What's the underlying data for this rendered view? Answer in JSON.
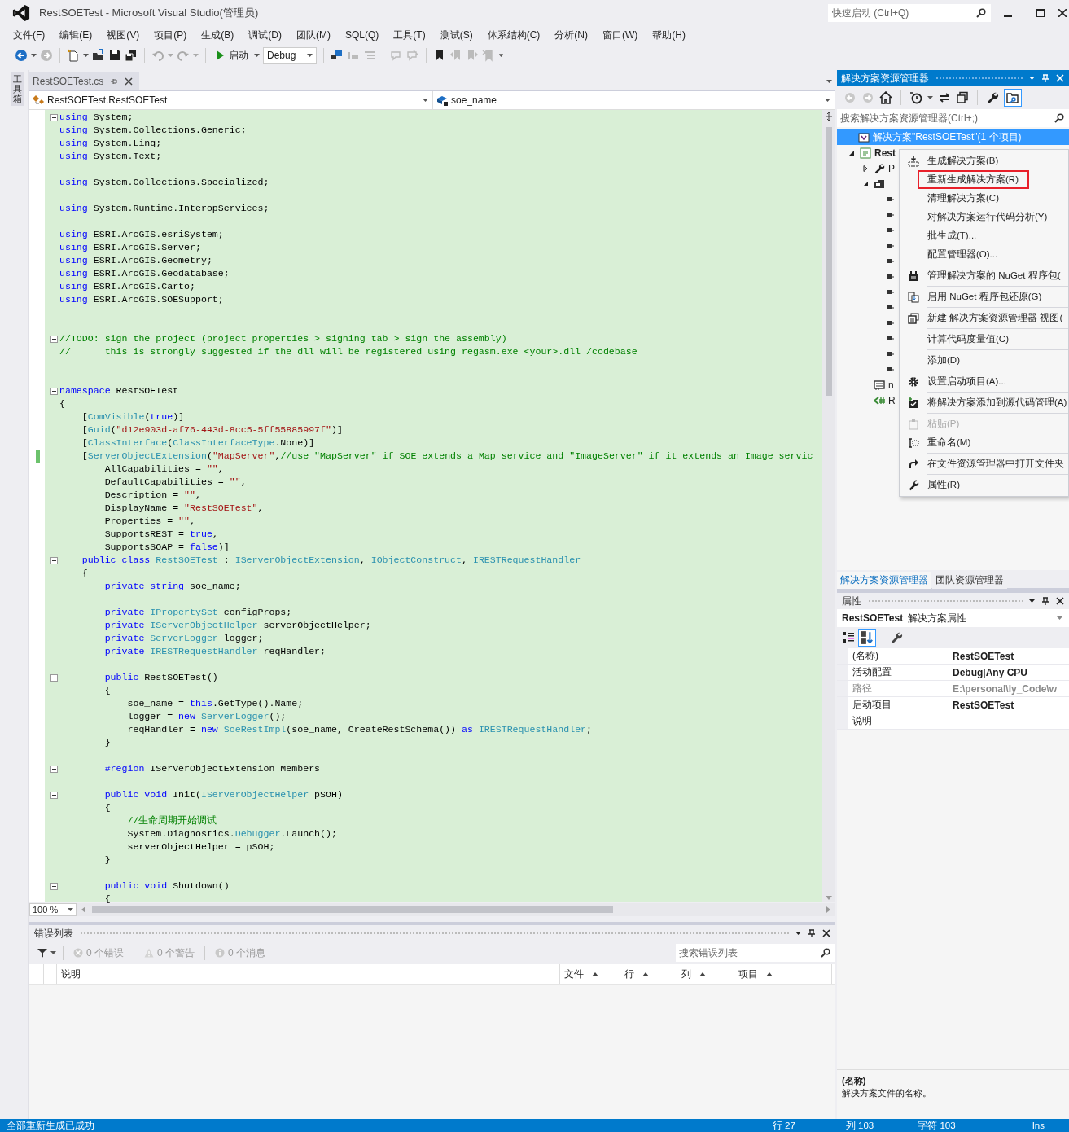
{
  "window": {
    "title": "RestSOETest - Microsoft Visual Studio(管理员)",
    "quick_launch": {
      "placeholder": "快速启动 (Ctrl+Q)"
    }
  },
  "menu": [
    "文件(F)",
    "编辑(E)",
    "视图(V)",
    "项目(P)",
    "生成(B)",
    "调试(D)",
    "团队(M)",
    "SQL(Q)",
    "工具(T)",
    "测试(S)",
    "体系结构(C)",
    "分析(N)",
    "窗口(W)",
    "帮助(H)"
  ],
  "toolbar": {
    "start_label": "启动",
    "configuration": "Debug"
  },
  "toolbox_tab": "工具箱",
  "document_tabs": [
    {
      "label": "RestSOETest.cs",
      "selected": true
    }
  ],
  "navigation": {
    "type_dropdown": "RestSOETest.RestSOETest",
    "member_dropdown": "soe_name"
  },
  "editor": {
    "zoom": "100 %",
    "lines": [
      {
        "fold": true,
        "modified": false,
        "tokens": [
          {
            "kind": "keyword",
            "text": "using"
          },
          {
            "kind": "plain",
            "text": " System;"
          }
        ]
      },
      {
        "fold": false,
        "modified": false,
        "tokens": [
          {
            "kind": "keyword",
            "text": "using"
          },
          {
            "kind": "plain",
            "text": " System.Collections.Generic;"
          }
        ]
      },
      {
        "fold": false,
        "modified": false,
        "tokens": [
          {
            "kind": "keyword",
            "text": "using"
          },
          {
            "kind": "plain",
            "text": " System.Linq;"
          }
        ]
      },
      {
        "fold": false,
        "modified": false,
        "tokens": [
          {
            "kind": "keyword",
            "text": "using"
          },
          {
            "kind": "plain",
            "text": " System.Text;"
          }
        ]
      },
      {
        "fold": false,
        "modified": false
      },
      {
        "fold": false,
        "modified": false,
        "tokens": [
          {
            "kind": "keyword",
            "text": "using"
          },
          {
            "kind": "plain",
            "text": " System.Collections.Specialized;"
          }
        ]
      },
      {
        "fold": false,
        "modified": false
      },
      {
        "fold": false,
        "modified": false,
        "tokens": [
          {
            "kind": "keyword",
            "text": "using"
          },
          {
            "kind": "plain",
            "text": " System.Runtime.InteropServices;"
          }
        ]
      },
      {
        "fold": false,
        "modified": false
      },
      {
        "fold": false,
        "modified": false,
        "tokens": [
          {
            "kind": "keyword",
            "text": "using"
          },
          {
            "kind": "plain",
            "text": " ESRI.ArcGIS.esriSystem;"
          }
        ]
      },
      {
        "fold": false,
        "modified": false,
        "tokens": [
          {
            "kind": "keyword",
            "text": "using"
          },
          {
            "kind": "plain",
            "text": " ESRI.ArcGIS.Server;"
          }
        ]
      },
      {
        "fold": false,
        "modified": false,
        "tokens": [
          {
            "kind": "keyword",
            "text": "using"
          },
          {
            "kind": "plain",
            "text": " ESRI.ArcGIS.Geometry;"
          }
        ]
      },
      {
        "fold": false,
        "modified": false,
        "tokens": [
          {
            "kind": "keyword",
            "text": "using"
          },
          {
            "kind": "plain",
            "text": " ESRI.ArcGIS.Geodatabase;"
          }
        ]
      },
      {
        "fold": false,
        "modified": false,
        "tokens": [
          {
            "kind": "keyword",
            "text": "using"
          },
          {
            "kind": "plain",
            "text": " ESRI.ArcGIS.Carto;"
          }
        ]
      },
      {
        "fold": false,
        "modified": false,
        "tokens": [
          {
            "kind": "keyword",
            "text": "using"
          },
          {
            "kind": "plain",
            "text": " ESRI.ArcGIS.SOESupport;"
          }
        ]
      },
      {
        "fold": false,
        "modified": false
      },
      {
        "fold": false,
        "modified": false
      },
      {
        "fold": true,
        "modified": false,
        "tokens": [
          {
            "kind": "comment",
            "text": "//TODO: sign the project (project properties > signing tab > sign the assembly)"
          }
        ]
      },
      {
        "fold": false,
        "modified": false,
        "tokens": [
          {
            "kind": "comment",
            "text": "//      this is strongly suggested if the dll will be registered using regasm.exe <your>.dll /codebase"
          }
        ]
      },
      {
        "fold": false,
        "modified": false
      },
      {
        "fold": false,
        "modified": false
      },
      {
        "fold": true,
        "modified": false,
        "tokens": [
          {
            "kind": "keyword",
            "text": "namespace"
          },
          {
            "kind": "plain",
            "text": " RestSOETest"
          }
        ]
      },
      {
        "fold": false,
        "modified": false,
        "tokens": [
          {
            "kind": "plain",
            "text": "{"
          }
        ]
      },
      {
        "fold": false,
        "modified": false,
        "tokens": [
          {
            "kind": "plain",
            "text": "    ["
          },
          {
            "kind": "type",
            "text": "ComVisible"
          },
          {
            "kind": "plain",
            "text": "("
          },
          {
            "kind": "keyword",
            "text": "true"
          },
          {
            "kind": "plain",
            "text": ")]"
          }
        ]
      },
      {
        "fold": false,
        "modified": false,
        "tokens": [
          {
            "kind": "plain",
            "text": "    ["
          },
          {
            "kind": "type",
            "text": "Guid"
          },
          {
            "kind": "plain",
            "text": "("
          },
          {
            "kind": "string",
            "text": "\"d12e903d-af76-443d-8cc5-5ff55885997f\""
          },
          {
            "kind": "plain",
            "text": ")]"
          }
        ]
      },
      {
        "fold": false,
        "modified": false,
        "tokens": [
          {
            "kind": "plain",
            "text": "    ["
          },
          {
            "kind": "type",
            "text": "ClassInterface"
          },
          {
            "kind": "plain",
            "text": "("
          },
          {
            "kind": "type",
            "text": "ClassInterfaceType"
          },
          {
            "kind": "plain",
            "text": ".None)]"
          }
        ]
      },
      {
        "fold": false,
        "modified": true,
        "tokens": [
          {
            "kind": "plain",
            "text": "    ["
          },
          {
            "kind": "type",
            "text": "ServerObjectExtension"
          },
          {
            "kind": "plain",
            "text": "("
          },
          {
            "kind": "string",
            "text": "\"MapServer\""
          },
          {
            "kind": "plain",
            "text": ","
          },
          {
            "kind": "comment",
            "text": "//use \"MapServer\" if SOE extends a Map service and \"ImageServer\" if it extends an Image servic"
          }
        ]
      },
      {
        "fold": false,
        "modified": false,
        "tokens": [
          {
            "kind": "plain",
            "text": "        AllCapabilities = "
          },
          {
            "kind": "string",
            "text": "\"\""
          },
          {
            "kind": "plain",
            "text": ","
          }
        ]
      },
      {
        "fold": false,
        "modified": false,
        "tokens": [
          {
            "kind": "plain",
            "text": "        DefaultCapabilities = "
          },
          {
            "kind": "string",
            "text": "\"\""
          },
          {
            "kind": "plain",
            "text": ","
          }
        ]
      },
      {
        "fold": false,
        "modified": false,
        "tokens": [
          {
            "kind": "plain",
            "text": "        Description = "
          },
          {
            "kind": "string",
            "text": "\"\""
          },
          {
            "kind": "plain",
            "text": ","
          }
        ]
      },
      {
        "fold": false,
        "modified": false,
        "tokens": [
          {
            "kind": "plain",
            "text": "        DisplayName = "
          },
          {
            "kind": "string",
            "text": "\"RestSOETest\""
          },
          {
            "kind": "plain",
            "text": ","
          }
        ]
      },
      {
        "fold": false,
        "modified": false,
        "tokens": [
          {
            "kind": "plain",
            "text": "        Properties = "
          },
          {
            "kind": "string",
            "text": "\"\""
          },
          {
            "kind": "plain",
            "text": ","
          }
        ]
      },
      {
        "fold": false,
        "modified": false,
        "tokens": [
          {
            "kind": "plain",
            "text": "        SupportsREST = "
          },
          {
            "kind": "keyword",
            "text": "true"
          },
          {
            "kind": "plain",
            "text": ","
          }
        ]
      },
      {
        "fold": false,
        "modified": false,
        "tokens": [
          {
            "kind": "plain",
            "text": "        SupportsSOAP = "
          },
          {
            "kind": "keyword",
            "text": "false"
          },
          {
            "kind": "plain",
            "text": ")]"
          }
        ]
      },
      {
        "fold": true,
        "modified": false,
        "tokens": [
          {
            "kind": "keyword",
            "text": "    public class "
          },
          {
            "kind": "type",
            "text": "RestSOETest"
          },
          {
            "kind": "plain",
            "text": " : "
          },
          {
            "kind": "type",
            "text": "IServerObjectExtension"
          },
          {
            "kind": "plain",
            "text": ", "
          },
          {
            "kind": "type",
            "text": "IObjectConstruct"
          },
          {
            "kind": "plain",
            "text": ", "
          },
          {
            "kind": "type",
            "text": "IRESTRequestHandler"
          }
        ]
      },
      {
        "fold": false,
        "modified": false,
        "tokens": [
          {
            "kind": "plain",
            "text": "    {"
          }
        ]
      },
      {
        "fold": false,
        "modified": false,
        "tokens": [
          {
            "kind": "keyword",
            "text": "        private string"
          },
          {
            "kind": "plain",
            "text": " soe_name;"
          }
        ]
      },
      {
        "fold": false,
        "modified": false
      },
      {
        "fold": false,
        "modified": false,
        "tokens": [
          {
            "kind": "keyword",
            "text": "        private "
          },
          {
            "kind": "type",
            "text": "IPropertySet"
          },
          {
            "kind": "plain",
            "text": " configProps;"
          }
        ]
      },
      {
        "fold": false,
        "modified": false,
        "tokens": [
          {
            "kind": "keyword",
            "text": "        private "
          },
          {
            "kind": "type",
            "text": "IServerObjectHelper"
          },
          {
            "kind": "plain",
            "text": " serverObjectHelper;"
          }
        ]
      },
      {
        "fold": false,
        "modified": false,
        "tokens": [
          {
            "kind": "keyword",
            "text": "        private "
          },
          {
            "kind": "type",
            "text": "ServerLogger"
          },
          {
            "kind": "plain",
            "text": " logger;"
          }
        ]
      },
      {
        "fold": false,
        "modified": false,
        "tokens": [
          {
            "kind": "keyword",
            "text": "        private "
          },
          {
            "kind": "type",
            "text": "IRESTRequestHandler"
          },
          {
            "kind": "plain",
            "text": " reqHandler;"
          }
        ]
      },
      {
        "fold": false,
        "modified": false
      },
      {
        "fold": true,
        "modified": false,
        "tokens": [
          {
            "kind": "keyword",
            "text": "        public"
          },
          {
            "kind": "plain",
            "text": " RestSOETest()"
          }
        ]
      },
      {
        "fold": false,
        "modified": false,
        "tokens": [
          {
            "kind": "plain",
            "text": "        {"
          }
        ]
      },
      {
        "fold": false,
        "modified": false,
        "tokens": [
          {
            "kind": "plain",
            "text": "            soe_name = "
          },
          {
            "kind": "keyword",
            "text": "this"
          },
          {
            "kind": "plain",
            "text": ".GetType().Name;"
          }
        ]
      },
      {
        "fold": false,
        "modified": false,
        "tokens": [
          {
            "kind": "plain",
            "text": "            logger = "
          },
          {
            "kind": "keyword",
            "text": "new "
          },
          {
            "kind": "type",
            "text": "ServerLogger"
          },
          {
            "kind": "plain",
            "text": "();"
          }
        ]
      },
      {
        "fold": false,
        "modified": false,
        "tokens": [
          {
            "kind": "plain",
            "text": "            reqHandler = "
          },
          {
            "kind": "keyword",
            "text": "new "
          },
          {
            "kind": "type",
            "text": "SoeRestImpl"
          },
          {
            "kind": "plain",
            "text": "(soe_name, CreateRestSchema()) "
          },
          {
            "kind": "keyword",
            "text": "as "
          },
          {
            "kind": "type",
            "text": "IRESTRequestHandler"
          },
          {
            "kind": "plain",
            "text": ";"
          }
        ]
      },
      {
        "fold": false,
        "modified": false,
        "tokens": [
          {
            "kind": "plain",
            "text": "        }"
          }
        ]
      },
      {
        "fold": false,
        "modified": false
      },
      {
        "fold": true,
        "modified": false,
        "tokens": [
          {
            "kind": "keyword",
            "text": "        #region"
          },
          {
            "kind": "plain",
            "text": " IServerObjectExtension Members"
          }
        ]
      },
      {
        "fold": false,
        "modified": false
      },
      {
        "fold": true,
        "modified": false,
        "tokens": [
          {
            "kind": "keyword",
            "text": "        public void"
          },
          {
            "kind": "plain",
            "text": " Init("
          },
          {
            "kind": "type",
            "text": "IServerObjectHelper"
          },
          {
            "kind": "plain",
            "text": " pSOH)"
          }
        ]
      },
      {
        "fold": false,
        "modified": false,
        "tokens": [
          {
            "kind": "plain",
            "text": "        {"
          }
        ]
      },
      {
        "fold": false,
        "modified": false,
        "tokens": [
          {
            "kind": "comment",
            "text": "            //生命周期开始调试"
          }
        ]
      },
      {
        "fold": false,
        "modified": false,
        "tokens": [
          {
            "kind": "plain",
            "text": "            System.Diagnostics."
          },
          {
            "kind": "type",
            "text": "Debugger"
          },
          {
            "kind": "plain",
            "text": ".Launch();"
          }
        ]
      },
      {
        "fold": false,
        "modified": false,
        "tokens": [
          {
            "kind": "plain",
            "text": "            serverObjectHelper = pSOH;"
          }
        ]
      },
      {
        "fold": false,
        "modified": false,
        "tokens": [
          {
            "kind": "plain",
            "text": "        }"
          }
        ]
      },
      {
        "fold": false,
        "modified": false
      },
      {
        "fold": true,
        "modified": false,
        "tokens": [
          {
            "kind": "keyword",
            "text": "        public void"
          },
          {
            "kind": "plain",
            "text": " Shutdown()"
          }
        ]
      },
      {
        "fold": false,
        "modified": false,
        "tokens": [
          {
            "kind": "plain",
            "text": "        {"
          }
        ]
      }
    ]
  },
  "error_list": {
    "title": "错误列表",
    "filters": [
      {
        "kind": "error",
        "label": "0 个错误"
      },
      {
        "kind": "warning",
        "label": "0 个警告"
      },
      {
        "kind": "message",
        "label": "0 个消息"
      }
    ],
    "search": {
      "placeholder": "搜索错误列表"
    },
    "columns": [
      {
        "label": "说明",
        "sorted": false
      },
      {
        "label": "文件",
        "sorted": true
      },
      {
        "label": "行",
        "sorted": true
      },
      {
        "label": "列",
        "sorted": true
      },
      {
        "label": "项目",
        "sorted": true
      }
    ]
  },
  "solution_explorer": {
    "title": "解决方案资源管理器",
    "search": {
      "placeholder": "搜索解决方案资源管理器(Ctrl+;)"
    },
    "tree": [
      {
        "kind": "solution",
        "label": "解决方案\"RestSOETest\"(1 个项目)",
        "selected": true,
        "children": [
          {
            "kind": "project",
            "label": "Rest",
            "selected": false,
            "expanded": true,
            "children": [
              {
                "kind": "properties",
                "label": "P",
                "selected": false,
                "expanded": false
              },
              {
                "kind": "references",
                "selected": false,
                "expanded": true,
                "children": [
                  {
                    "kind": "reference",
                    "selected": false
                  },
                  {
                    "kind": "reference",
                    "selected": false
                  },
                  {
                    "kind": "reference",
                    "selected": false
                  },
                  {
                    "kind": "reference",
                    "selected": false
                  },
                  {
                    "kind": "reference",
                    "selected": false
                  },
                  {
                    "kind": "reference",
                    "selected": false
                  },
                  {
                    "kind": "reference",
                    "selected": false
                  },
                  {
                    "kind": "reference",
                    "selected": false
                  },
                  {
                    "kind": "reference",
                    "selected": false
                  },
                  {
                    "kind": "reference",
                    "selected": false
                  },
                  {
                    "kind": "reference",
                    "selected": false
                  },
                  {
                    "kind": "reference",
                    "selected": false
                  }
                ]
              },
              {
                "kind": "config",
                "label": "n",
                "selected": false
              },
              {
                "kind": "code",
                "label": "R",
                "selected": false
              }
            ]
          }
        ]
      }
    ]
  },
  "context_menu": [
    {
      "label": "生成解决方案(B)",
      "separator_above": false,
      "disabled": false,
      "highlighted": false
    },
    {
      "label": "重新生成解决方案(R)",
      "separator_above": false,
      "disabled": false,
      "highlighted": true
    },
    {
      "label": "清理解决方案(C)",
      "separator_above": false,
      "disabled": false,
      "highlighted": false
    },
    {
      "label": "对解决方案运行代码分析(Y)",
      "separator_above": false,
      "disabled": false,
      "highlighted": false
    },
    {
      "label": "批生成(T)...",
      "separator_above": false,
      "disabled": false,
      "highlighted": false
    },
    {
      "label": "配置管理器(O)...",
      "separator_above": false,
      "disabled": false,
      "highlighted": false
    },
    {
      "label": "管理解决方案的 NuGet 程序包(",
      "separator_above": true,
      "disabled": false,
      "highlighted": false
    },
    {
      "label": "启用 NuGet 程序包还原(G)",
      "separator_above": true,
      "disabled": false,
      "highlighted": false
    },
    {
      "label": "新建 解决方案资源管理器 视图(",
      "separator_above": true,
      "disabled": false,
      "highlighted": false
    },
    {
      "label": "计算代码度量值(C)",
      "separator_above": true,
      "disabled": false,
      "highlighted": false
    },
    {
      "label": "添加(D)",
      "separator_above": true,
      "disabled": false,
      "highlighted": false
    },
    {
      "label": "设置启动项目(A)...",
      "separator_above": true,
      "disabled": false,
      "highlighted": false
    },
    {
      "label": "将解决方案添加到源代码管理(A)",
      "separator_above": true,
      "disabled": false,
      "highlighted": false
    },
    {
      "label": "粘贴(P)",
      "separator_above": true,
      "disabled": true,
      "highlighted": false
    },
    {
      "label": "重命名(M)",
      "separator_above": false,
      "disabled": false,
      "highlighted": false
    },
    {
      "label": "在文件资源管理器中打开文件夹",
      "separator_above": true,
      "disabled": false,
      "highlighted": false
    },
    {
      "label": "属性(R)",
      "separator_above": true,
      "disabled": false,
      "highlighted": false
    }
  ],
  "panel_tabs": [
    {
      "label": "解决方案资源管理器",
      "selected": true
    },
    {
      "label": "团队资源管理器",
      "selected": false
    }
  ],
  "properties": {
    "title": "属性",
    "object_name": "RestSOETest",
    "object_type": "解决方案属性",
    "rows": [
      {
        "name": "(名称)",
        "value": "RestSOETest",
        "disabled": false
      },
      {
        "name": "活动配置",
        "value": "Debug|Any CPU",
        "disabled": false
      },
      {
        "name": "路径",
        "value": "E:\\personal\\ly_Code\\w",
        "disabled": true
      },
      {
        "name": "启动项目",
        "value": "RestSOETest",
        "disabled": false
      },
      {
        "name": "说明",
        "disabled": false
      }
    ],
    "description": {
      "title": "(名称)",
      "text": "解决方案文件的名称。"
    }
  },
  "status_bar": {
    "message": "全部重新生成已成功",
    "line": "行 27",
    "column": "列 103",
    "char": "字符 103",
    "mode": "Ins"
  }
}
